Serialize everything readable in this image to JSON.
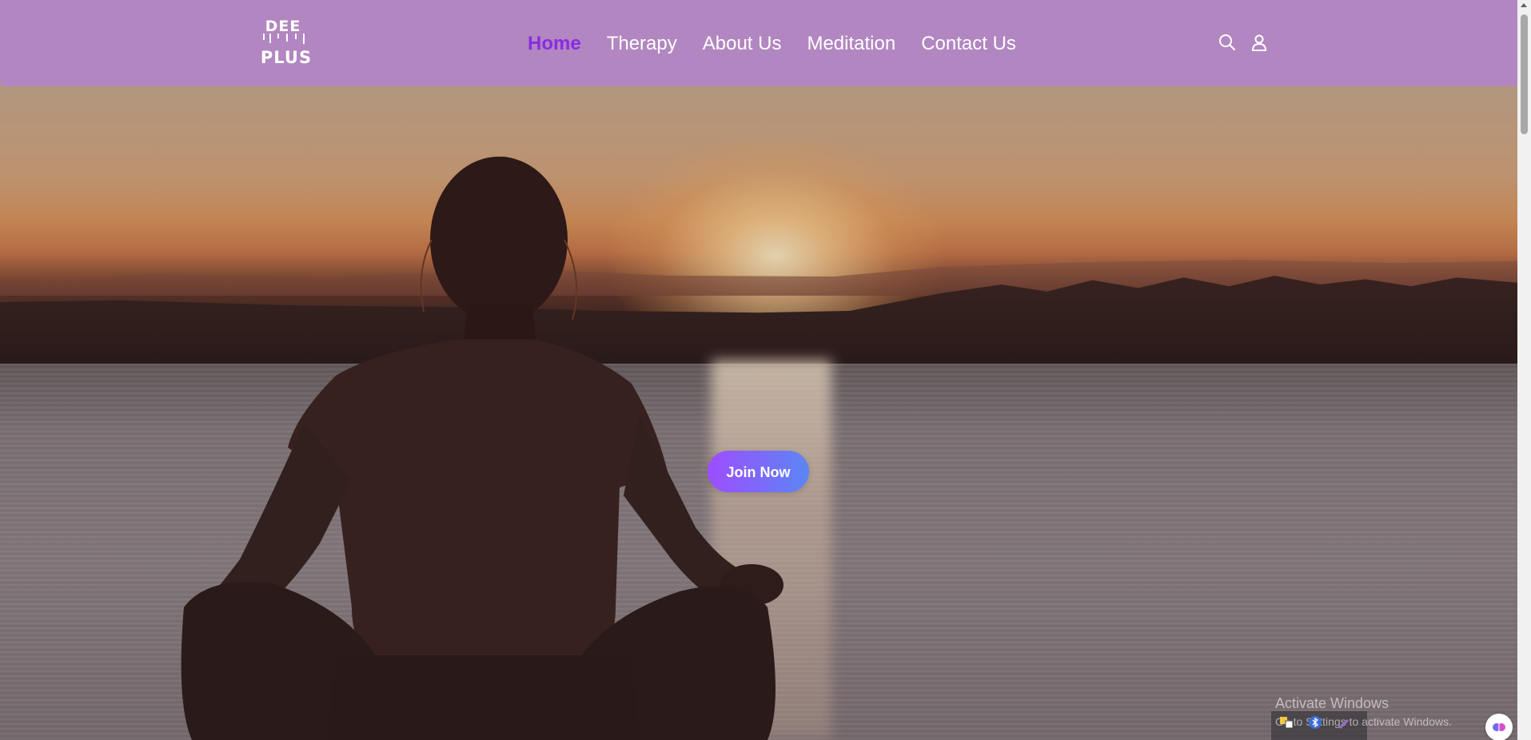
{
  "header": {
    "logo_line1": "DEE",
    "logo_line2": "PLUS",
    "nav": [
      {
        "label": "Home",
        "active": true
      },
      {
        "label": "Therapy",
        "active": false
      },
      {
        "label": "About Us",
        "active": false
      },
      {
        "label": "Meditation",
        "active": false
      },
      {
        "label": "Contact Us",
        "active": false
      }
    ],
    "icons": [
      "search-icon",
      "user-icon"
    ],
    "background_color": "#b286c0",
    "active_color": "#8a2be2"
  },
  "hero": {
    "cta_label": "Join Now",
    "image_subject": "woman meditating by lake at sunset"
  },
  "overlay": {
    "activate_title": "Activate Windows",
    "activate_sub": "Go to Settings to activate Windows."
  }
}
